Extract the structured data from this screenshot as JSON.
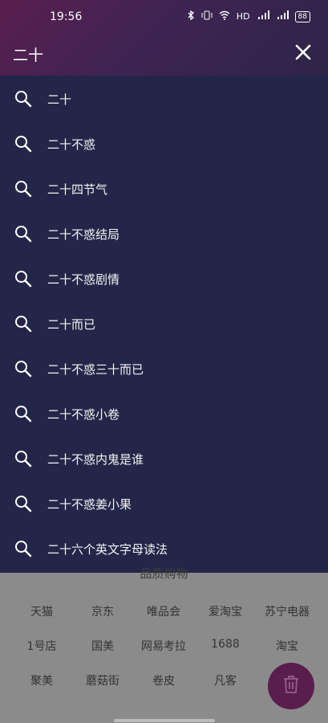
{
  "status": {
    "time": "19:56",
    "battery": "88",
    "net": "HD",
    "sig1": "5G",
    "sig2": "4G"
  },
  "search": {
    "query": "二十"
  },
  "suggestions": [
    {
      "label": "二十"
    },
    {
      "label": "二十不惑"
    },
    {
      "label": "二十四节气"
    },
    {
      "label": "二十不惑结局"
    },
    {
      "label": "二十不惑剧情"
    },
    {
      "label": "二十而已"
    },
    {
      "label": "二十不惑三十而已"
    },
    {
      "label": "二十不惑小卷"
    },
    {
      "label": "二十不惑内鬼是谁"
    },
    {
      "label": "二十不惑姜小果"
    },
    {
      "label": "二十六个英文字母读法"
    }
  ],
  "shopping": {
    "title": "品质购物",
    "row1": [
      "天猫",
      "京东",
      "唯品会",
      "爱淘宝",
      "苏宁电器"
    ],
    "row2": [
      "1号店",
      "国美",
      "网易考拉",
      "1688",
      "淘宝"
    ],
    "row3": [
      "聚美",
      "蘑菇街",
      "卷皮",
      "凡客"
    ]
  },
  "colors": {
    "header": "#3f2453",
    "list_bg": "#242649",
    "fab": "#5a1e4e"
  }
}
